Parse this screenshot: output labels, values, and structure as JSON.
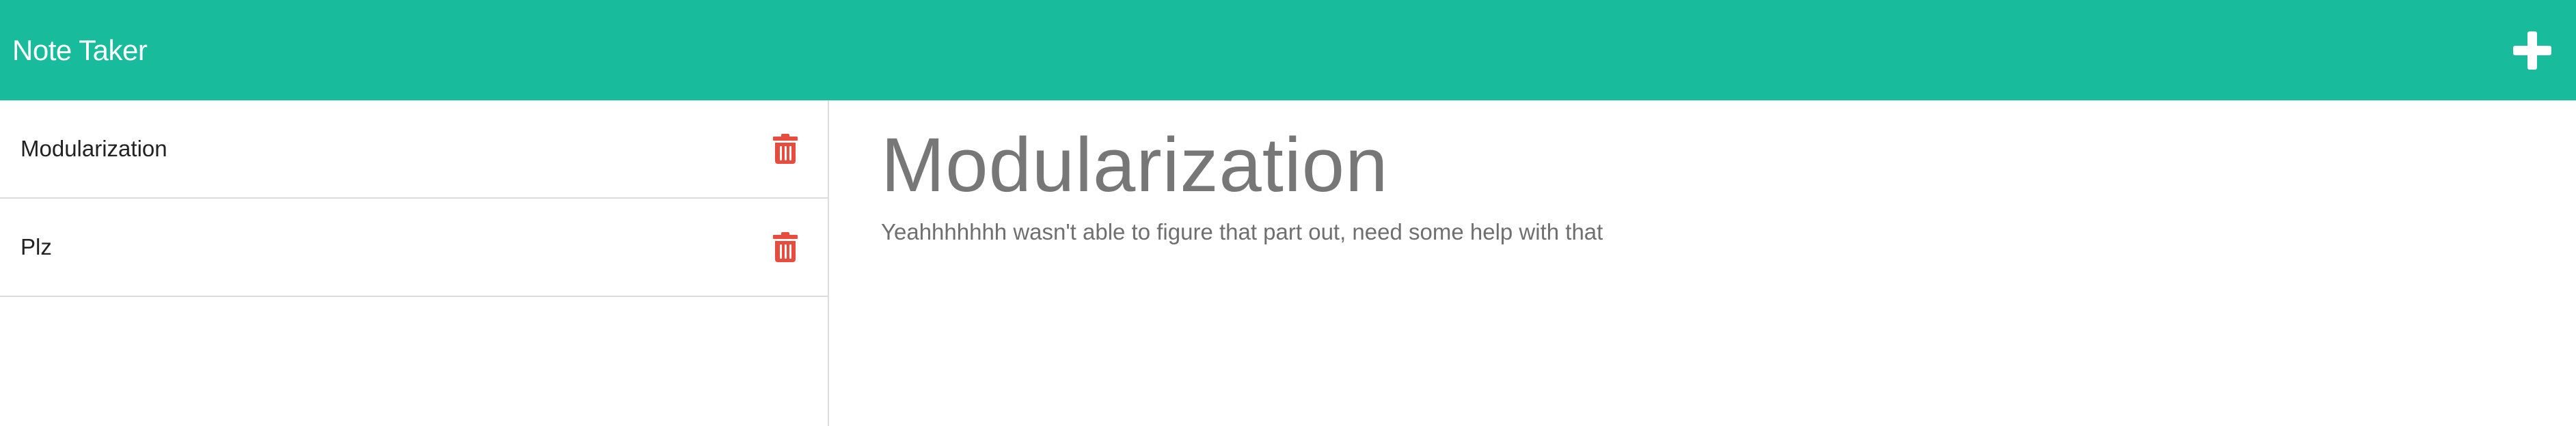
{
  "app": {
    "brand": "Note Taker"
  },
  "sidebar": {
    "items": [
      {
        "label": "Modularization"
      },
      {
        "label": "Plz"
      }
    ]
  },
  "note": {
    "title": "Modularization",
    "text": "Yeahhhhhhh wasn't able to figure that part out, need some help with that"
  },
  "colors": {
    "navbar": "#18bc9c",
    "delete": "#e74c3c"
  },
  "icons": {
    "add": "plus-icon",
    "delete": "trash-icon"
  }
}
